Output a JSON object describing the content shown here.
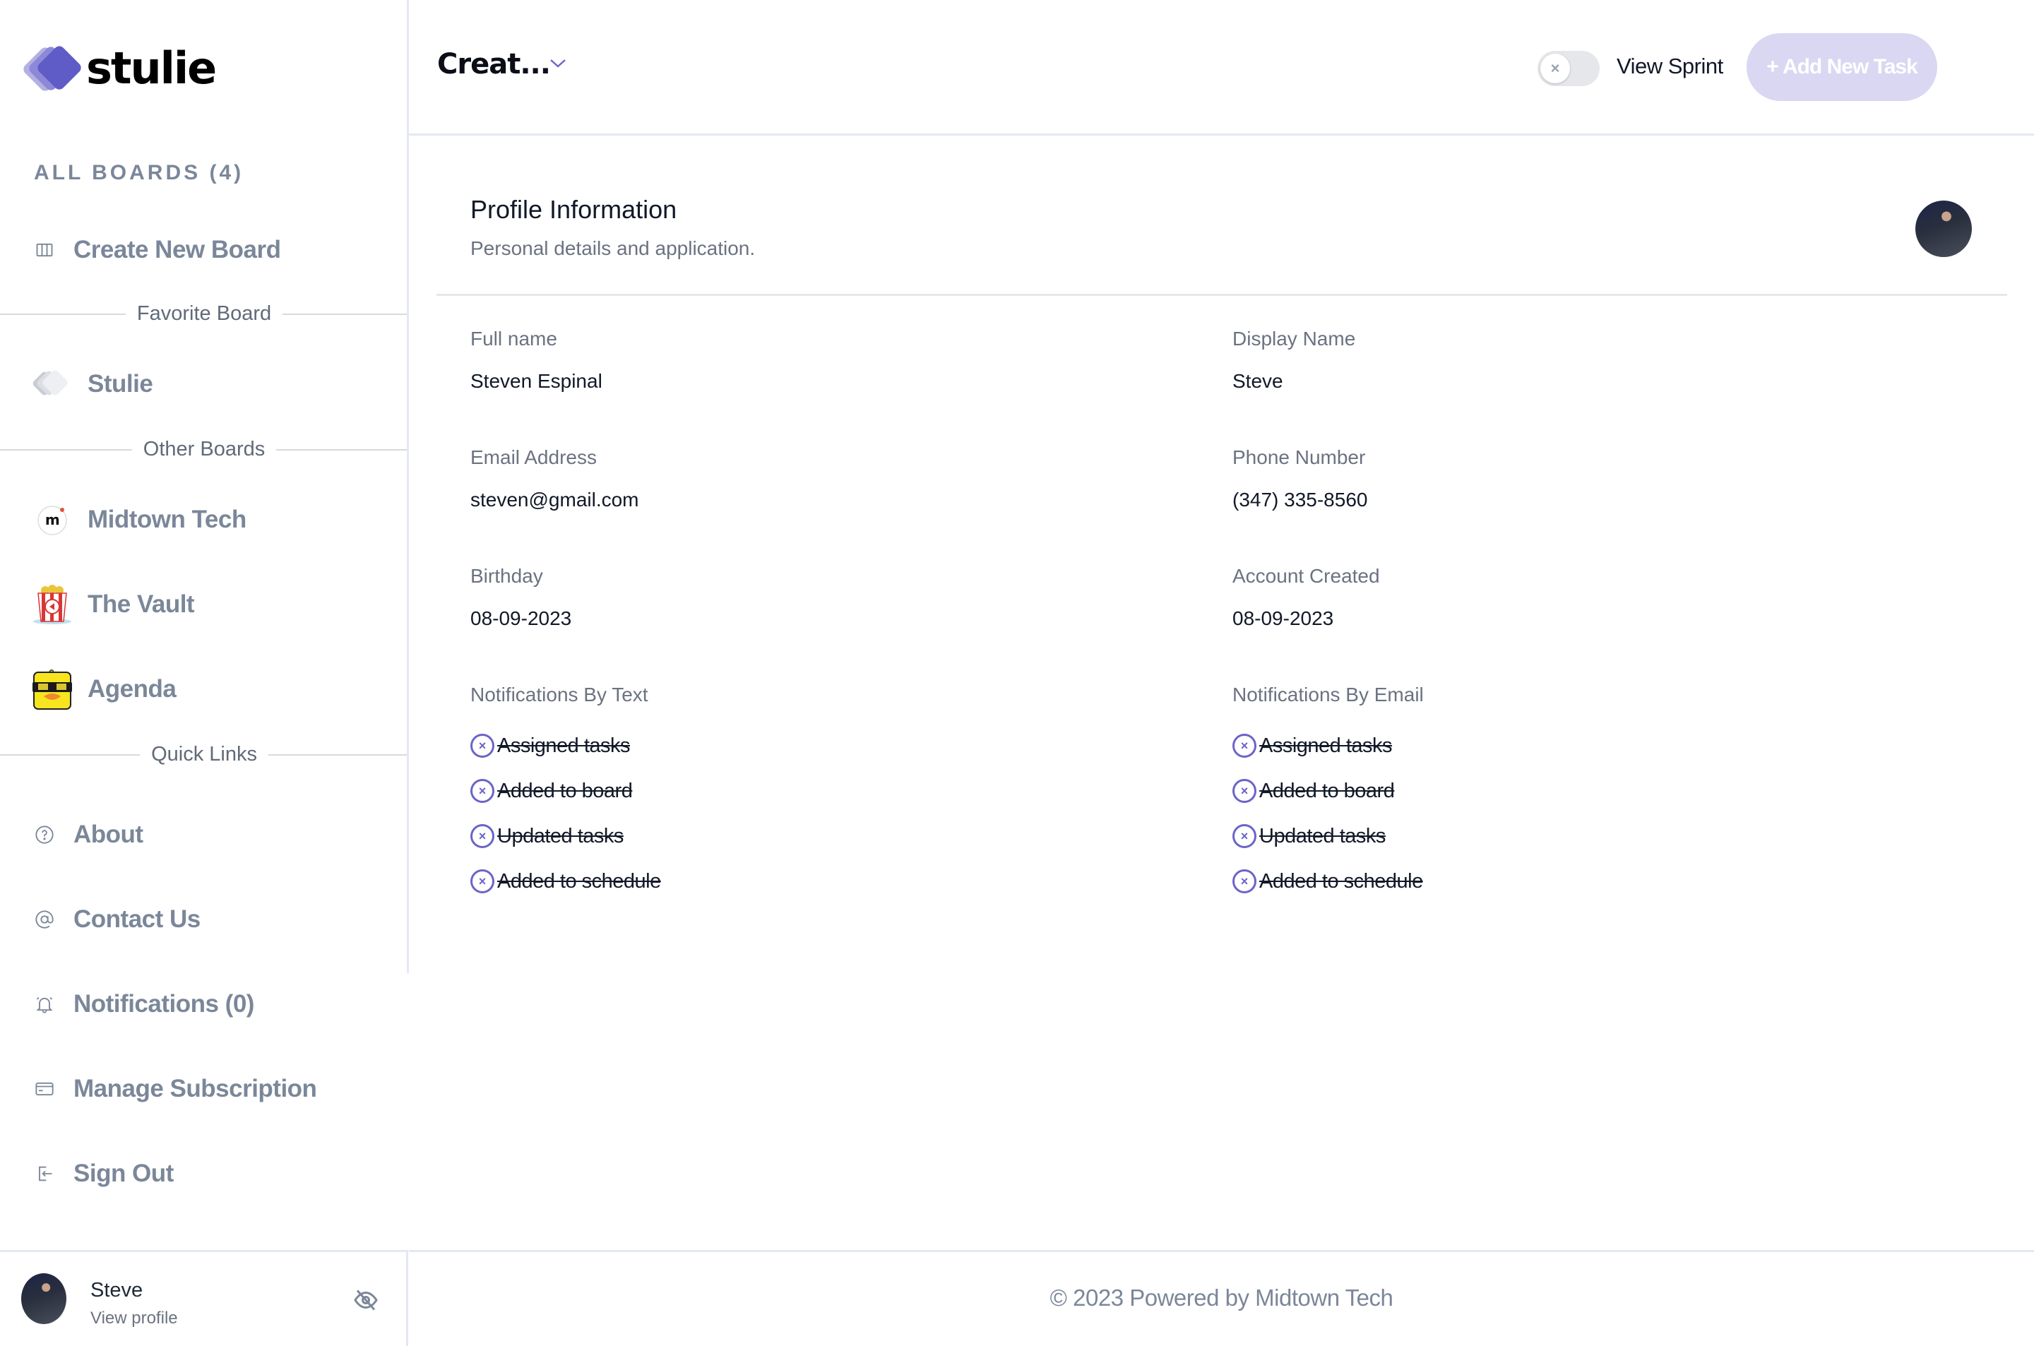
{
  "app": {
    "name": "stulie",
    "brand_color": "#5f5cc8"
  },
  "sidebar": {
    "all_boards_label": "ALL BOARDS (4)",
    "create_board": {
      "label": "Create New Board",
      "icon": "columns-icon"
    },
    "sections": {
      "favorite": "Favorite Board",
      "other": "Other Boards",
      "quick_links": "Quick Links"
    },
    "favorite_boards": [
      {
        "label": "Stulie",
        "icon": "stulie-logo-icon"
      }
    ],
    "other_boards": [
      {
        "label": "Midtown Tech",
        "icon": "midtown-logo-icon"
      },
      {
        "label": "The Vault",
        "icon": "popcorn-icon"
      },
      {
        "label": "Agenda",
        "icon": "duck-sunglasses-icon"
      }
    ],
    "quick_links": [
      {
        "label": "About",
        "icon": "question-circle-icon"
      },
      {
        "label": "Contact Us",
        "icon": "at-sign-icon"
      },
      {
        "label": "Notifications (0)",
        "icon": "bell-icon"
      },
      {
        "label": "Manage Subscription",
        "icon": "credit-card-icon"
      },
      {
        "label": "Sign Out",
        "icon": "sign-out-icon"
      }
    ],
    "user": {
      "name": "Steve",
      "link": "View profile",
      "toggle_icon": "eye-off-icon"
    }
  },
  "header": {
    "board_title": "Creat...",
    "view_sprint_label": "View Sprint",
    "view_sprint_on": false,
    "add_task_label": "+ Add New Task",
    "add_task_color": "#d9d7f1"
  },
  "profile": {
    "title": "Profile Information",
    "subtitle": "Personal details and application.",
    "fields": {
      "full_name": {
        "label": "Full name",
        "value": "Steven Espinal"
      },
      "display_name": {
        "label": "Display Name",
        "value": "Steve"
      },
      "email": {
        "label": "Email Address",
        "value": "steven@gmail.com"
      },
      "phone": {
        "label": "Phone Number",
        "value": "(347) 335-8560"
      },
      "birthday": {
        "label": "Birthday",
        "value": "08-09-2023"
      },
      "account_created": {
        "label": "Account Created",
        "value": "08-09-2023"
      }
    },
    "notifications_text": {
      "label": "Notifications By Text",
      "items": [
        "Assigned tasks",
        "Added to board",
        "Updated tasks",
        "Added to schedule"
      ],
      "enabled": [
        false,
        false,
        false,
        false
      ]
    },
    "notifications_email": {
      "label": "Notifications By Email",
      "items": [
        "Assigned tasks",
        "Added to board",
        "Updated tasks",
        "Added to schedule"
      ],
      "enabled": [
        false,
        false,
        false,
        false
      ]
    },
    "accent_color": "#6a64c9"
  },
  "footer": {
    "text": "© 2023 Powered by Midtown Tech"
  }
}
